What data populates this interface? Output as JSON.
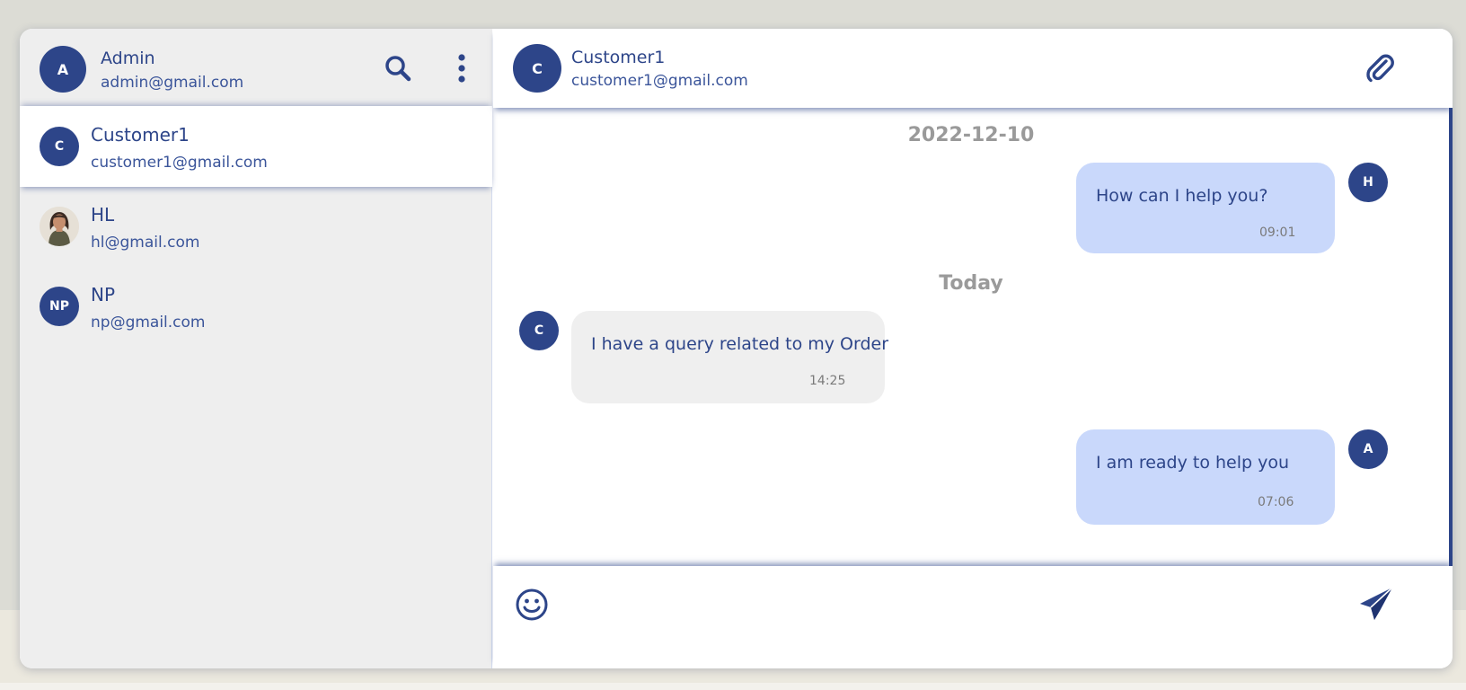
{
  "colors": {
    "accent": "#2d4589",
    "outgoing_bubble": "#c9d8fb",
    "incoming_bubble": "#efefef",
    "date_separator": "#9a9a9a"
  },
  "sidebar": {
    "user": {
      "avatar_initial": "A",
      "name": "Admin",
      "email": "admin@gmail.com"
    },
    "icons": [
      "search-icon",
      "more-vertical-icon"
    ],
    "contacts": [
      {
        "avatar_initial": "C",
        "name": "Customer1",
        "email": "customer1@gmail.com",
        "active": true
      },
      {
        "avatar_image": "profile-photo",
        "name": "HL",
        "email": "hl@gmail.com",
        "active": false
      },
      {
        "avatar_initial": "NP",
        "name": "NP",
        "email": "np@gmail.com",
        "active": false
      }
    ]
  },
  "chat": {
    "header": {
      "avatar_initial": "C",
      "name": "Customer1",
      "email": "customer1@gmail.com",
      "icon": "paperclip-icon"
    },
    "date_separators": [
      "2022-12-10",
      "Today"
    ],
    "messages": [
      {
        "direction": "out",
        "avatar_initial": "H",
        "text": "How can I help you?",
        "time": "09:01"
      },
      {
        "direction": "in",
        "avatar_initial": "C",
        "text": "I have a query related to my Order",
        "time": "14:25"
      },
      {
        "direction": "out",
        "avatar_initial": "A",
        "text": "I am ready to help you",
        "time": "07:06"
      }
    ],
    "composer": {
      "value": "",
      "placeholder": "",
      "icons": [
        "emoji-icon",
        "send-icon"
      ]
    }
  }
}
